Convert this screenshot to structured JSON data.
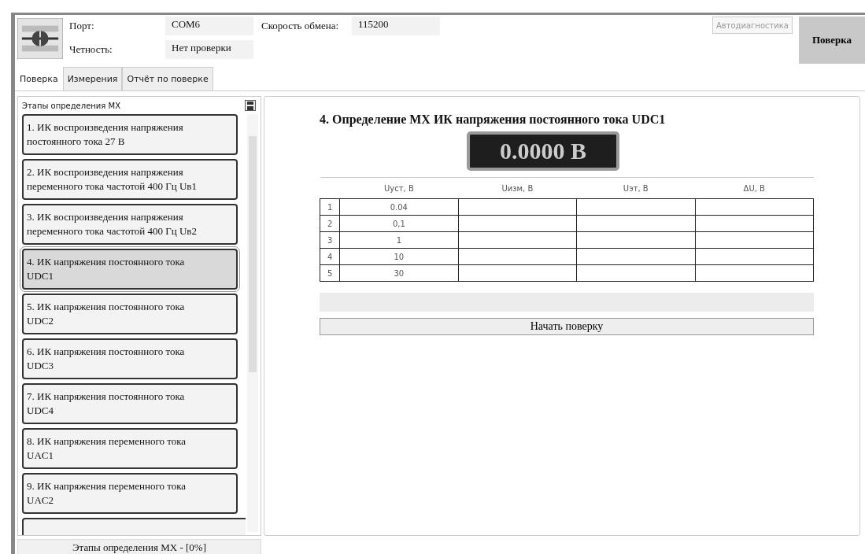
{
  "connection": {
    "port_label": "Порт:",
    "port": "COM6",
    "speed_label": "Скорость обмена:",
    "speed": "115200",
    "parity_label": "Четность:",
    "parity": "Нет проверки"
  },
  "autodiag_button": {
    "label": "Автодиагностика",
    "disabled": true
  },
  "verify_button": {
    "label": "Поверка"
  },
  "tabs": [
    {
      "label": "Поверка",
      "selected": true
    },
    {
      "label": "Измерения",
      "selected": false
    },
    {
      "label": "Отчёт по поверке",
      "selected": false
    }
  ],
  "stages": {
    "title": "Этапы определения МХ",
    "items": [
      {
        "label": "1. ИК воспроизведения напряжения постоянного тока 27 В",
        "selected": false
      },
      {
        "label": "2. ИК воспроизведения напряжения переменного тока частотой 400 Гц Uв1",
        "selected": false
      },
      {
        "label": "3. ИК воспроизведения напряжения переменного тока частотой 400 Гц Uв2",
        "selected": false
      },
      {
        "label": "4. ИК напряжения постоянного тока UDC1",
        "selected": true
      },
      {
        "label": "5. ИК напряжения постоянного тока UDC2",
        "selected": false
      },
      {
        "label": "6. ИК напряжения постоянного тока UDC3",
        "selected": false
      },
      {
        "label": "7. ИК напряжения постоянного тока UDC4",
        "selected": false
      },
      {
        "label": "8. ИК напряжения переменного тока UAC1",
        "selected": false
      },
      {
        "label": "9. ИК напряжения переменного тока UAC2",
        "selected": false
      }
    ]
  },
  "detail": {
    "title": "4. Определение МХ ИК напряжения постоянного тока UDC1",
    "reading": "0.0000 В",
    "table": {
      "columns": [
        "Uуст, В",
        "Uизм, В",
        "Uэт, В",
        "ΔU, В"
      ],
      "rows": [
        {
          "index": "1",
          "cells": [
            "0.04",
            "",
            "",
            ""
          ]
        },
        {
          "index": "2",
          "cells": [
            "0,1",
            "",
            "",
            ""
          ]
        },
        {
          "index": "3",
          "cells": [
            "1",
            "",
            "",
            ""
          ]
        },
        {
          "index": "4",
          "cells": [
            "10",
            "",
            "",
            ""
          ]
        },
        {
          "index": "5",
          "cells": [
            "30",
            "",
            "",
            ""
          ]
        }
      ]
    },
    "progress": {
      "level": 0
    },
    "start_button": "Начать поверку"
  },
  "status_bar": {
    "text": "Этапы определения МХ - [0%]"
  }
}
